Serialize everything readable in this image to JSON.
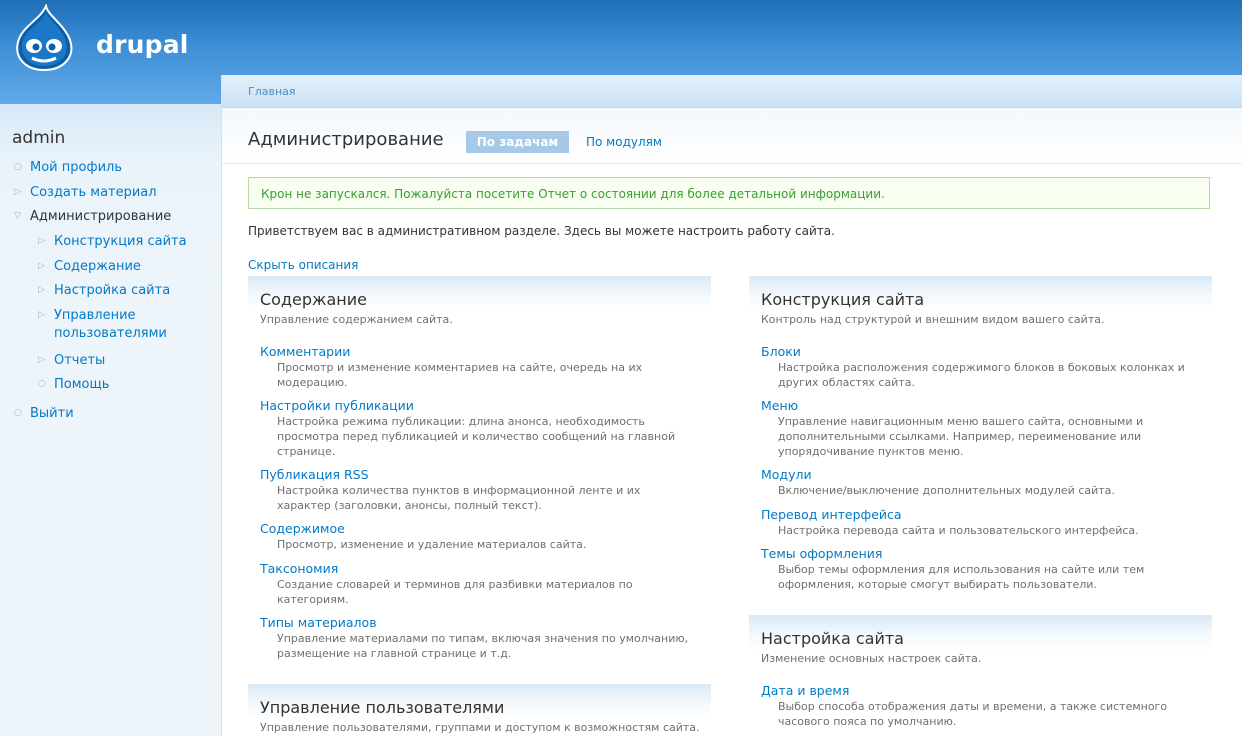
{
  "site": {
    "name": "drupal",
    "logo_icon": "drupal-drop-icon",
    "colors": {
      "header": "#3d8fd6",
      "link": "#027ac6",
      "status": "#39a031"
    }
  },
  "sidebar": {
    "user": "admin",
    "items": [
      {
        "label": "Мой профиль",
        "bullet": "circle"
      },
      {
        "label": "Создать материал",
        "bullet": "triangle-right"
      },
      {
        "label": "Администрирование",
        "bullet": "triangle-down"
      },
      {
        "label": "Конструкция сайта",
        "bullet": "triangle-right"
      },
      {
        "label": "Содержание",
        "bullet": "triangle-right"
      },
      {
        "label": "Настройка сайта",
        "bullet": "triangle-right"
      },
      {
        "label": "Управление пользователями",
        "line1": "Управление",
        "line2": "пользователями",
        "bullet": "triangle-right"
      },
      {
        "label": "Отчеты",
        "bullet": "triangle-right"
      },
      {
        "label": "Помощь",
        "bullet": "circle"
      },
      {
        "label": "Выйти",
        "bullet": "circle"
      }
    ]
  },
  "breadcrumb": "Главная",
  "page": {
    "title": "Администрирование",
    "tabs": {
      "tasks": "По задачам",
      "modules": "По модулям"
    },
    "status": {
      "before": "Крон не запускался. Пожалуйста посетите ",
      "link": "Отчет о состоянии",
      "after": " для более детальной информации."
    },
    "welcome": "Приветствуем вас в административном разделе. Здесь вы можете настроить работу сайта.",
    "hide_descriptions": "Скрыть описания"
  },
  "panels": {
    "content": {
      "title": "Содержание",
      "desc": "Управление содержанием сайта.",
      "entries": [
        {
          "title": "Комментарии",
          "desc": "Просмотр и изменение комментариев на сайте, очередь на их модерацию.",
          "d1": "Просмотр и изменение комментариев на сайте, очередь на их",
          "d2": "модерацию."
        },
        {
          "title": "Настройки публикации",
          "d1": "Настройка режима публикации: длина анонса, необходимость",
          "d2": "просмотра перед публикацией и количество сообщений на главной",
          "d3": "странице."
        },
        {
          "title": "Публикация RSS",
          "d1": "Настройка количества пунктов в информационной ленте и их",
          "d2": "характер (заголовки, анонсы, полный текст)."
        },
        {
          "title": "Содержимое",
          "d1": "Просмотр, изменение и удаление материалов сайта."
        },
        {
          "title": "Таксономия",
          "d1": "Создание словарей и терминов для разбивки материалов по",
          "d2": "категориям."
        },
        {
          "title": "Типы материалов",
          "d1": "Управление материалами по типам, включая значения по умолчанию,",
          "d2": "размещение на главной странице и т.д."
        }
      ]
    },
    "users": {
      "title": "Управление пользователями",
      "desc": "Управление пользователями, группами и доступом к возможностям сайта."
    },
    "structure": {
      "title": "Конструкция сайта",
      "desc": "Контроль над структурой и внешним видом вашего сайта.",
      "entries": [
        {
          "title": "Блоки",
          "d1": "Настройка расположения содержимого блоков в боковых колонках и",
          "d2": "других областях сайта."
        },
        {
          "title": "Меню",
          "d1": "Управление навигационным меню вашего сайта, основными и",
          "d2": "дополнительными ссылками. Например, переименование или",
          "d3": "упорядочивание пунктов меню."
        },
        {
          "title": "Модули",
          "d1": "Включение/выключение дополнительных модулей сайта."
        },
        {
          "title": "Перевод интерфейса",
          "d1": "Настройка перевода сайта и пользовательского интерфейса."
        },
        {
          "title": "Темы оформления",
          "d1": "Выбор темы оформления для использования на сайте или тем",
          "d2": "оформления, которые смогут выбирать пользователи."
        }
      ]
    },
    "settings": {
      "title": "Настройка сайта",
      "desc": "Изменение основных настроек сайта.",
      "entries": [
        {
          "title": "Дата и время",
          "d1": "Выбор способа отображения даты и времени, а также системного",
          "d2": "часового пояса по умолчанию."
        }
      ]
    }
  }
}
